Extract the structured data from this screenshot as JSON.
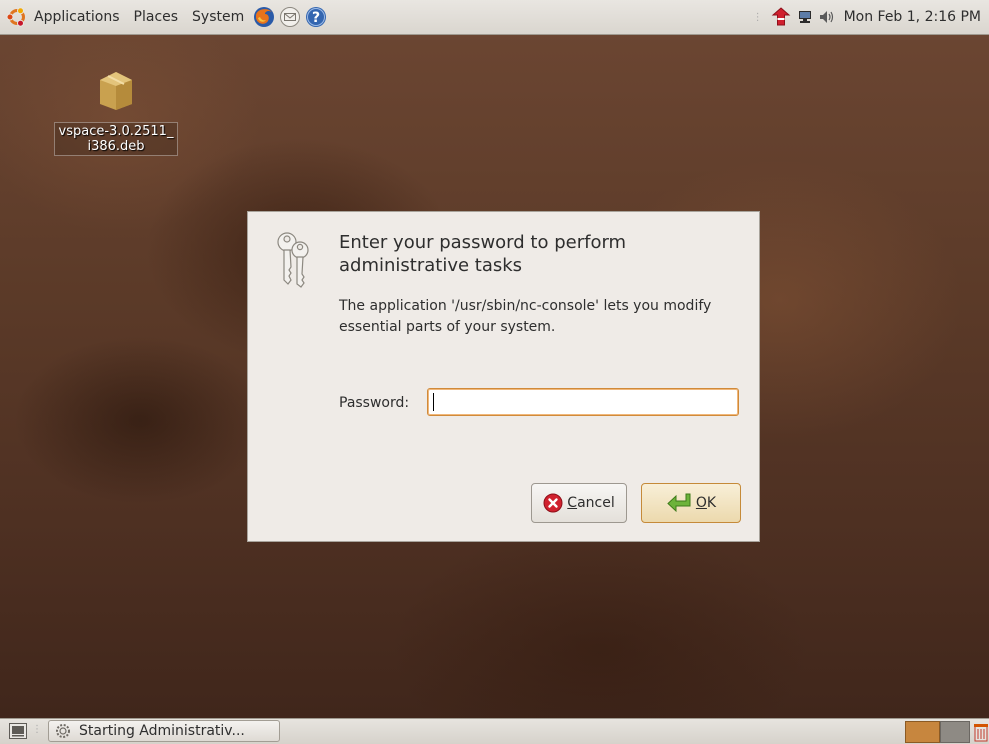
{
  "top_panel": {
    "menus": {
      "applications": "Applications",
      "places": "Places",
      "system": "System"
    },
    "clock": "Mon Feb  1,  2:16 PM"
  },
  "desktop": {
    "file_label": "vspace-3.0.2511_\ni386.deb"
  },
  "dialog": {
    "heading": "Enter your password to perform administrative tasks",
    "message": "The application '/usr/sbin/nc-console' lets you modify essential parts of your system.",
    "password_label": "Password:",
    "password_value": "",
    "cancel_prefix": "",
    "cancel_mnemonic": "C",
    "cancel_rest": "ancel",
    "ok_mnemonic": "O",
    "ok_rest": "K"
  },
  "bottom_panel": {
    "task_label": "Starting Administrativ..."
  },
  "colors": {
    "dialog_bg": "#efebe7",
    "input_focus": "#d08a3a",
    "workspace_active": "#c7863e"
  }
}
